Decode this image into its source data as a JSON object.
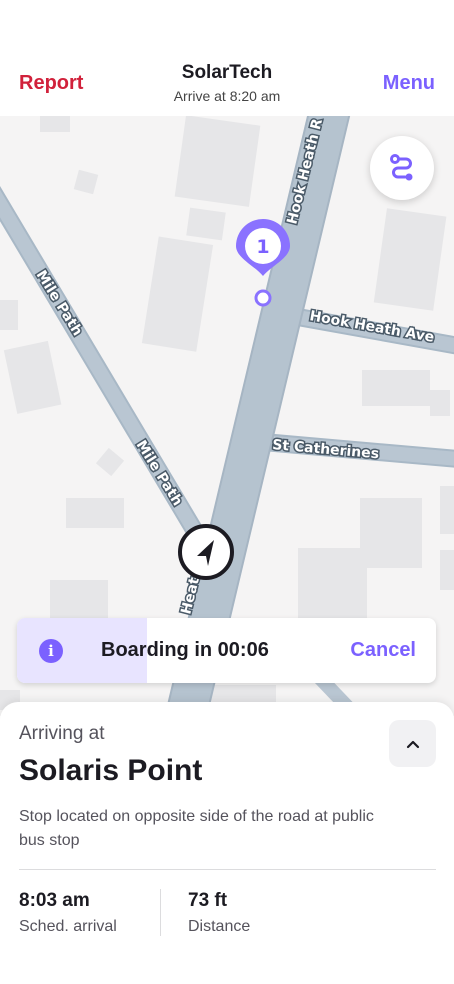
{
  "header": {
    "left_action": "Report",
    "title": "SolarTech",
    "subtitle": "Arrive at 8:20 am",
    "right_action": "Menu"
  },
  "map": {
    "roads": {
      "hook_heath_road": "Hook Heath R",
      "hook_heath_avenue": "Hook Heath Ave",
      "st_catherines": "St Catherines",
      "mile_path_upper": "Mile Path",
      "mile_path_lower": "Mile Path",
      "hook_heath_lower": "Heat"
    },
    "stop_marker_number": "1",
    "route_button_icon": "route-icon",
    "vehicle_icon": "navigation-arrow-icon"
  },
  "banner": {
    "text": "Boarding in 00:06",
    "cancel": "Cancel",
    "icon": "info-icon",
    "progress": 0.31
  },
  "sheet": {
    "label": "Arriving at",
    "stop_name": "Solaris Point",
    "description": "Stop located on opposite side of the road at public bus stop",
    "scheduled_value": "8:03 am",
    "scheduled_label": "Sched. arrival",
    "distance_value": "73 ft",
    "distance_label": "Distance"
  },
  "colors": {
    "accent": "#7b61ff",
    "danger": "#d1213b",
    "road": "#b5c3cf",
    "building": "#e6e6e8"
  }
}
